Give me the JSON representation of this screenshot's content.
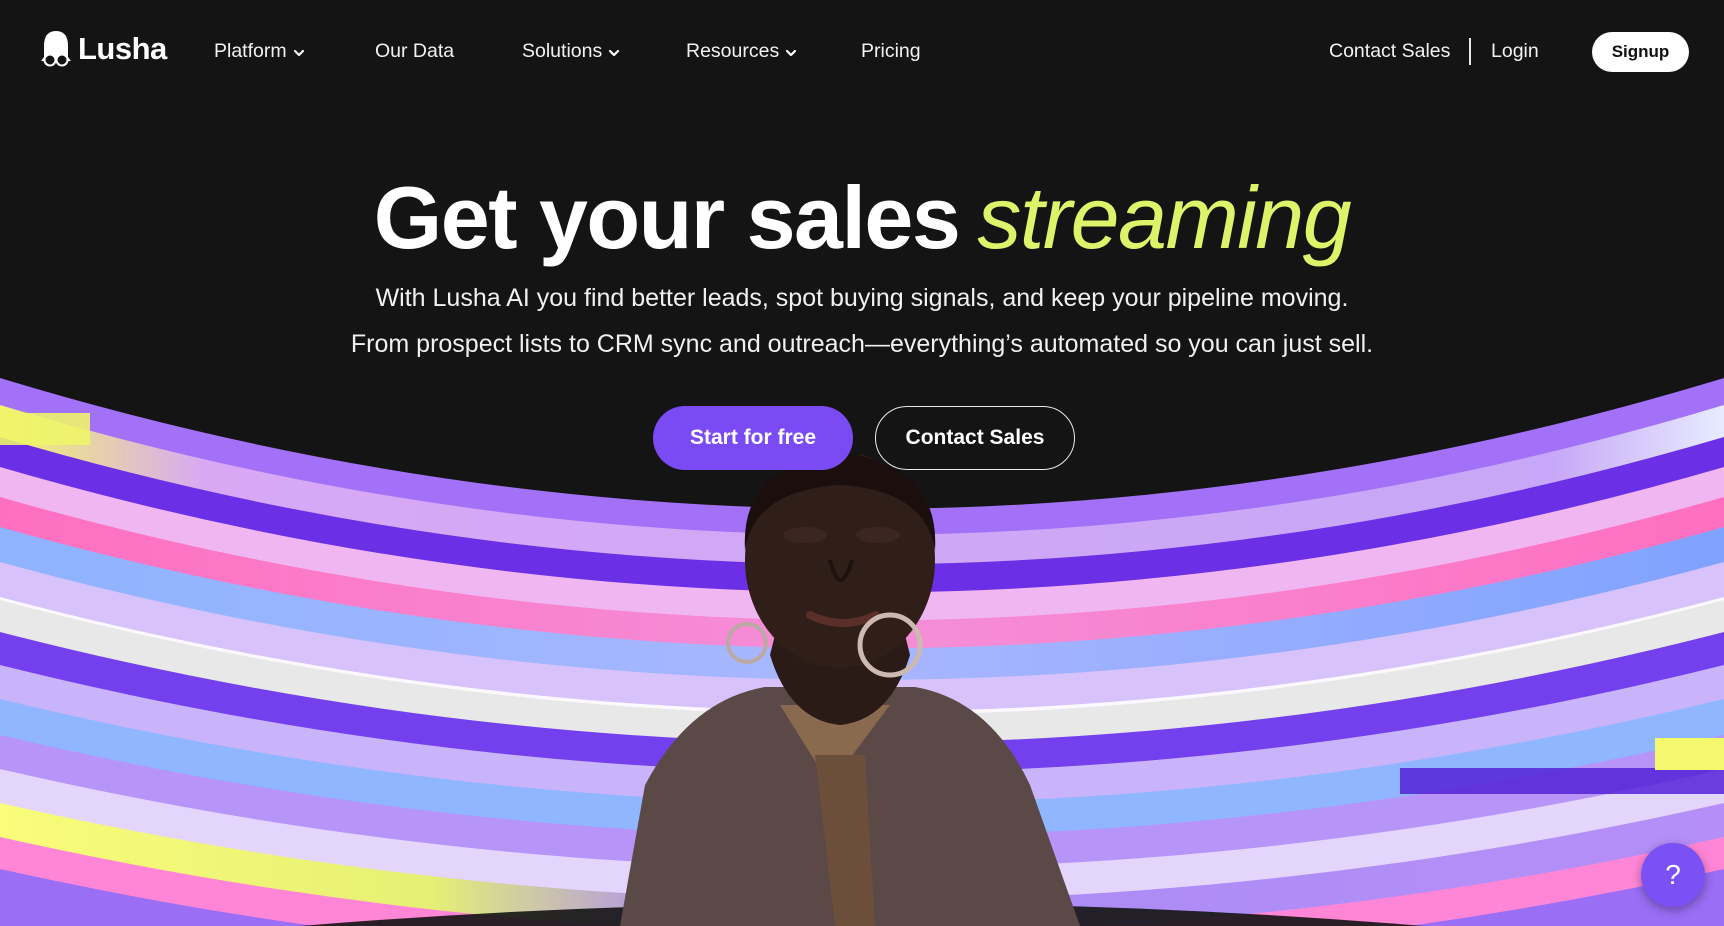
{
  "brand": {
    "name": "Lusha",
    "logo_icon": "lusha-logo-icon"
  },
  "nav": {
    "items": [
      {
        "label": "Platform",
        "has_dropdown": true
      },
      {
        "label": "Our Data",
        "has_dropdown": false
      },
      {
        "label": "Solutions",
        "has_dropdown": true
      },
      {
        "label": "Resources",
        "has_dropdown": true
      },
      {
        "label": "Pricing",
        "has_dropdown": false
      }
    ],
    "contact_sales": "Contact Sales",
    "login": "Login",
    "signup": "Signup"
  },
  "hero": {
    "title_main": "Get your sales",
    "title_accent": "streaming",
    "subtitle_line1": "With Lusha AI you find better leads, spot buying signals, and keep your pipeline moving.",
    "subtitle_line2": "From prospect lists to CRM sync and outreach—everything’s automated so you can just sell.",
    "cta_primary": "Start for free",
    "cta_secondary": "Contact Sales"
  },
  "help": {
    "label": "?"
  },
  "colors": {
    "background": "#141414",
    "accent_yellow": "#dcf36a",
    "primary_purple": "#7a4bf4",
    "help_purple": "#7b50f5"
  }
}
